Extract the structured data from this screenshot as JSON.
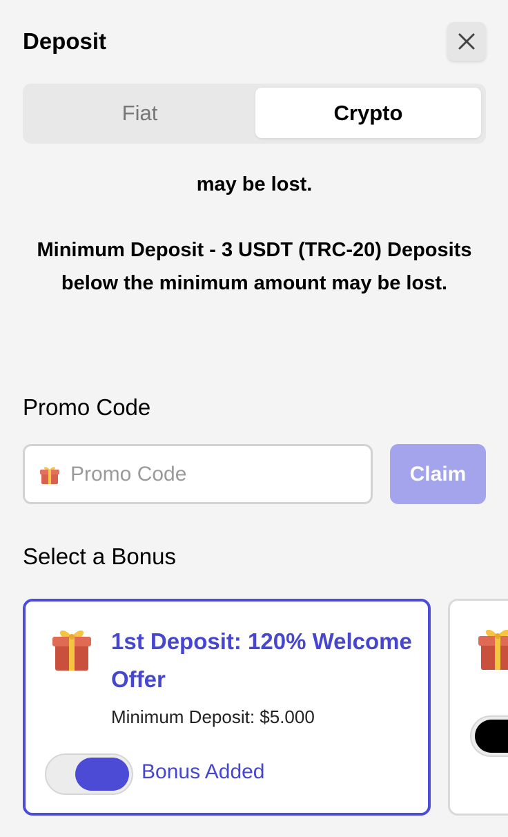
{
  "header": {
    "title": "Deposit",
    "close_icon": "close-icon"
  },
  "tabs": [
    {
      "label": "Fiat",
      "active": false
    },
    {
      "label": "Crypto",
      "active": true
    }
  ],
  "notice": {
    "fragment": "may be lost.",
    "main": "Minimum Deposit - 3 USDT (TRC-20) Deposits below the minimum amount may be lost."
  },
  "promo": {
    "section_label": "Promo Code",
    "input_icon": "gift-icon",
    "placeholder": "Promo Code",
    "value": "",
    "claim_label": "Claim"
  },
  "bonus": {
    "section_label": "Select a Bonus",
    "cards": [
      {
        "icon": "gift-icon",
        "title": "1st Deposit: 120% Welcome Offer",
        "min_deposit": "Minimum Deposit: $5.000",
        "toggle_on": true,
        "toggle_label": "Bonus Added"
      },
      {
        "icon": "gift-icon",
        "toggle_on": false
      }
    ]
  },
  "colors": {
    "accent": "#4646cf",
    "claim_disabled": "#a3a4eb",
    "background": "#f4f4f4"
  }
}
